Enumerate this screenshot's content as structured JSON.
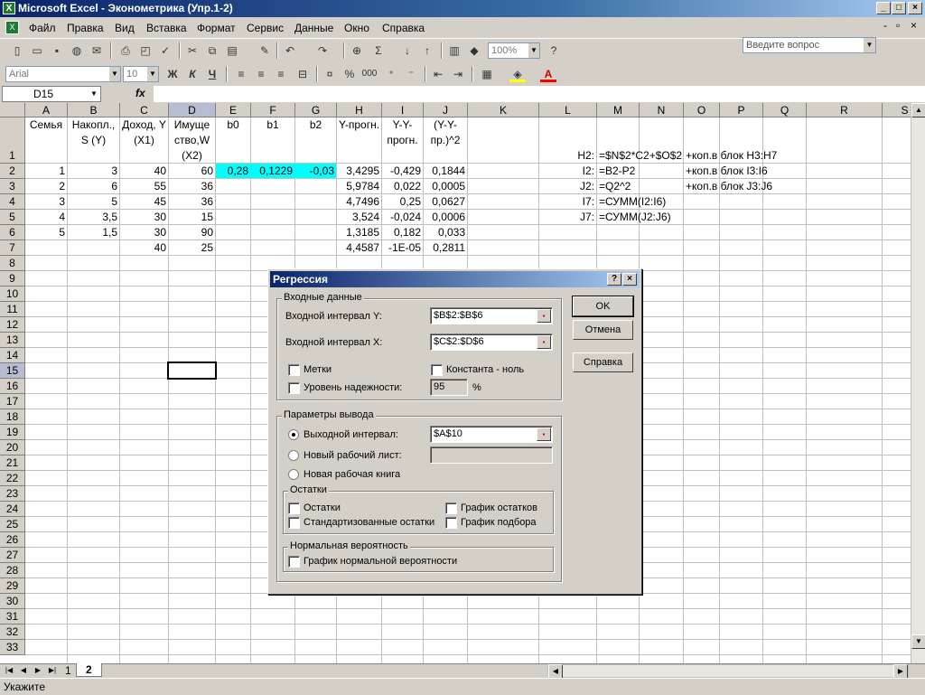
{
  "window": {
    "title": "Microsoft Excel - Эконометрика (Упр.1-2)",
    "app_icon": "excel-icon"
  },
  "menu": [
    "Файл",
    "Правка",
    "Вид",
    "Вставка",
    "Формат",
    "Сервис",
    "Данные",
    "Окно",
    "Справка"
  ],
  "ask_placeholder": "Введите вопрос",
  "toolbar": {
    "zoom": "100%",
    "font": "Arial",
    "size": "10",
    "bold": "Ж",
    "italic": "К",
    "underline": "Ч",
    "sigma": "Σ",
    "percent": "%",
    "thousands": "000"
  },
  "name_box": "D15",
  "fx": "fx",
  "columns": [
    "A",
    "B",
    "C",
    "D",
    "E",
    "F",
    "G",
    "H",
    "I",
    "J",
    "K",
    "L",
    "M",
    "N",
    "O",
    "P",
    "Q",
    "R",
    "S"
  ],
  "rows": [
    "1",
    "2",
    "3",
    "4",
    "5",
    "6",
    "7",
    "8",
    "9",
    "10",
    "11",
    "12",
    "13",
    "14",
    "15",
    "16",
    "17",
    "18",
    "19",
    "20",
    "21",
    "22",
    "23",
    "24",
    "25",
    "26",
    "27",
    "28",
    "29",
    "30",
    "31",
    "32",
    "33"
  ],
  "headers": {
    "A": "Семья",
    "B": "Накопл., S (Y)",
    "C": "Доход, Y (X1)",
    "D": "Имуще ство,W (X2)",
    "E": "b0",
    "F": "b1",
    "G": "b2",
    "H": "Y-прогн.",
    "I": "Y-Y-прогн.",
    "J": "(Y-Y-пр.)^2"
  },
  "data": [
    [
      "1",
      "3",
      "40",
      "60",
      "0,28",
      "0,1229",
      "-0,03",
      "3,4295",
      "-0,429",
      "0,1844"
    ],
    [
      "2",
      "6",
      "55",
      "36",
      "",
      "",
      "",
      "5,9784",
      "0,022",
      "0,0005"
    ],
    [
      "3",
      "5",
      "45",
      "36",
      "",
      "",
      "",
      "4,7496",
      "0,25",
      "0,0627"
    ],
    [
      "4",
      "3,5",
      "30",
      "15",
      "",
      "",
      "",
      "3,524",
      "-0,024",
      "0,0006"
    ],
    [
      "5",
      "1,5",
      "30",
      "90",
      "",
      "",
      "",
      "1,3185",
      "0,182",
      "0,033"
    ],
    [
      "",
      "",
      "40",
      "25",
      "",
      "",
      "",
      "4,4587",
      "-1E-05",
      "0,2811"
    ]
  ],
  "notes": [
    {
      "label": "H2:",
      "formula": "=$N$2*C2+$O$2",
      "comment": "+коп.в блок H3:H7"
    },
    {
      "label": "I2:",
      "formula": "=B2-P2",
      "comment": "+коп.в блок I3:I6"
    },
    {
      "label": "J2:",
      "formula": "=Q2^2",
      "comment": "+коп.в блок J3:J6"
    },
    {
      "label": "I7:",
      "formula": "=СУММ(I2:I6)",
      "comment": ""
    },
    {
      "label": "J7:",
      "formula": "=СУММ(J2:J6)",
      "comment": ""
    }
  ],
  "sheet_tabs": [
    "1",
    "2"
  ],
  "status": "Укажите",
  "dialog": {
    "title": "Регрессия",
    "help_q": "?",
    "input_group": "Входные данные",
    "y_label": "Входной интервал Y:",
    "y_value": "$B$2:$B$6",
    "x_label": "Входной интервал X:",
    "x_value": "$C$2:$D$6",
    "labels_chk": "Метки",
    "const_chk": "Константа - ноль",
    "conf_chk": "Уровень надежности:",
    "conf_value": "95",
    "pct": "%",
    "output_group": "Параметры вывода",
    "out_range": "Выходной интервал:",
    "out_value": "$A$10",
    "new_sheet": "Новый рабочий лист:",
    "new_book": "Новая рабочая книга",
    "resid_group": "Остатки",
    "resid": "Остатки",
    "std_resid": "Стандартизованные остатки",
    "resid_plot": "График остатков",
    "fit_plot": "График подбора",
    "norm_group": "Нормальная вероятность",
    "norm_plot": "График нормальной вероятности",
    "ok": "OK",
    "cancel": "Отмена",
    "help": "Справка"
  }
}
